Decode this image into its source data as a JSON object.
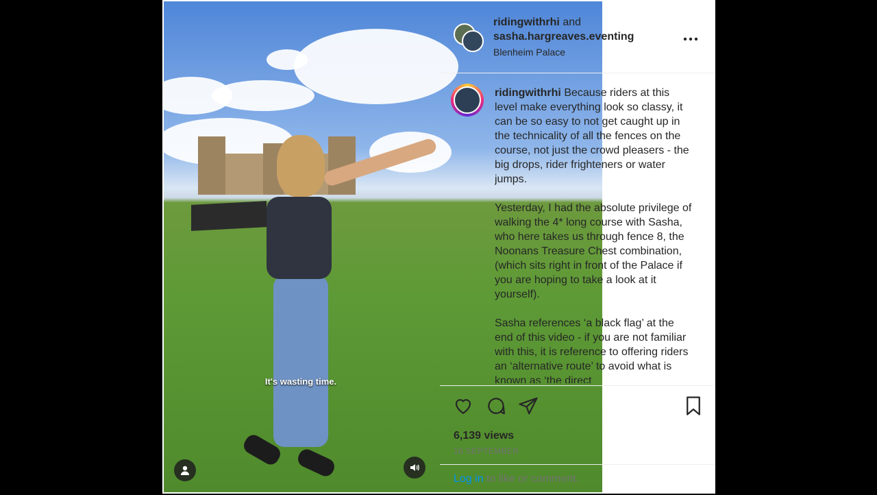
{
  "video": {
    "subtitle": "It's wasting time."
  },
  "header": {
    "user1": "ridingwithrhi",
    "joiner": " and",
    "user2": "sasha.hargreaves.eventing",
    "location": "Blenheim Palace",
    "more_icon": "more-horizontal-icon"
  },
  "caption": {
    "username": "ridingwithrhi",
    "paragraphs": [
      "Because riders at this level make everything look so classy, it can be so easy to not get caught up in the technicality of all the fences on the course, not just the crowd pleasers - the big drops, rider frighteners or water jumps.",
      "Yesterday, I had the absolute privilege of walking the 4* long course with Sasha, who here takes us through fence 8, the Noonans Treasure Chest combination, (which sits right in front of the Palace if you are hoping to take a look at it yourself).",
      "Sasha references ‘a black flag’ at the end of this video - if you are not familiar with this, it is reference to offering riders an ‘alternative route’ to avoid what is known as ‘the direct"
    ]
  },
  "actions": {
    "icons": [
      "heart-icon",
      "comment-icon",
      "share-icon",
      "bookmark-icon"
    ],
    "views": "6,139 views",
    "date": "16 SEPTEMBER"
  },
  "login": {
    "link": "Log in",
    "rest": " to like or comment."
  },
  "colors": {
    "link": "#0095f6",
    "text": "#262626",
    "muted": "#737373"
  }
}
